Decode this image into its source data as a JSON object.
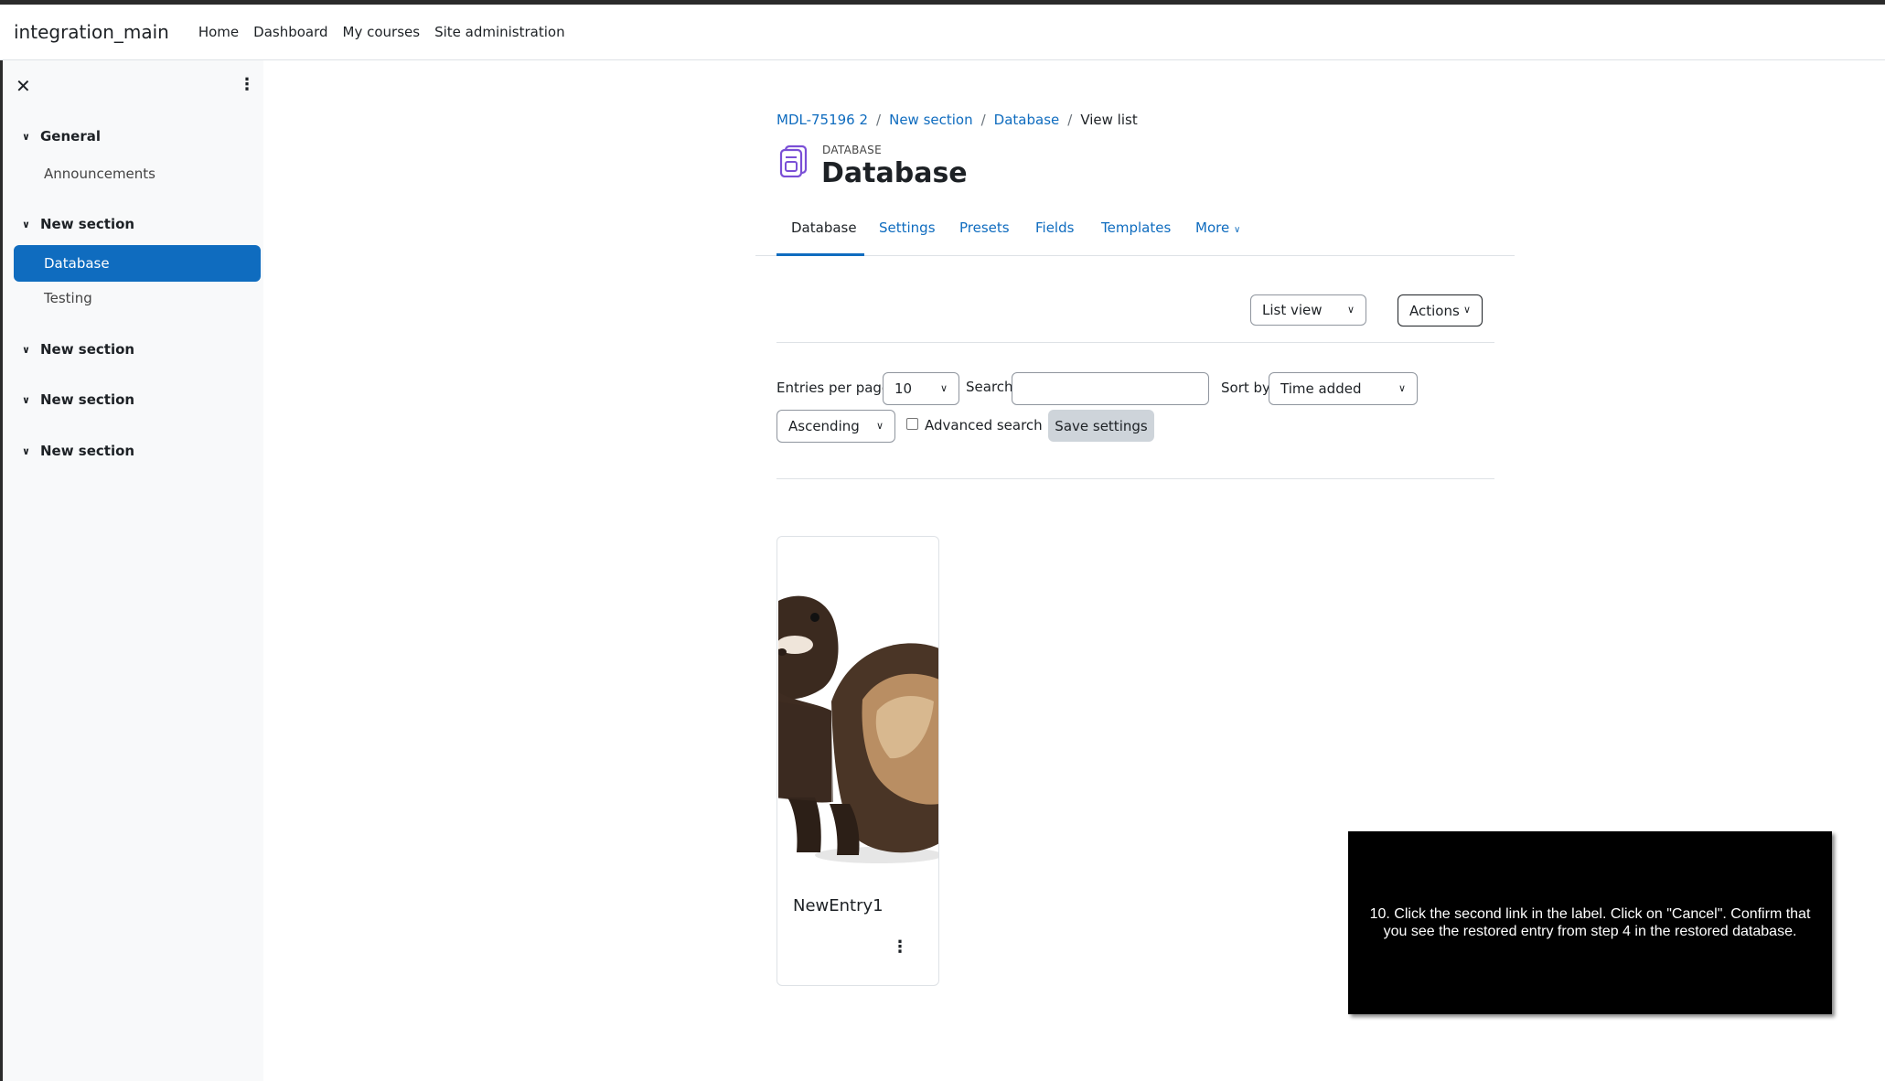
{
  "navbar": {
    "brand": "integration_main",
    "links": [
      "Home",
      "Dashboard",
      "My courses",
      "Site administration"
    ]
  },
  "drawer": {
    "close_glyph": "✕",
    "sections": [
      {
        "title": "General",
        "items": [
          "Announcements"
        ]
      },
      {
        "title": "New section",
        "items": [
          "Database",
          "Testing"
        ],
        "active_item": "Database"
      },
      {
        "title": "New section",
        "items": []
      },
      {
        "title": "New section",
        "items": []
      },
      {
        "title": "New section",
        "items": []
      }
    ]
  },
  "breadcrumb": {
    "items": [
      "MDL-75196 2",
      "New section",
      "Database"
    ],
    "current": "View list",
    "separator": "/"
  },
  "header": {
    "module_type": "DATABASE",
    "title": "Database",
    "icon": "database-module-icon"
  },
  "tabs": {
    "items": [
      "Database",
      "Settings",
      "Presets",
      "Fields",
      "Templates",
      "More"
    ],
    "active": "Database"
  },
  "view_controls": {
    "view_select": "List view",
    "actions_label": "Actions"
  },
  "filters": {
    "entries_per_page_label": "Entries per page",
    "entries_per_page_value": "10",
    "search_label": "Search",
    "search_value": "",
    "sort_by_label": "Sort by",
    "sort_by_value": "Time added",
    "order_value": "Ascending",
    "advanced_search_label": "Advanced search",
    "advanced_search_checked": false,
    "save_label": "Save settings"
  },
  "entries": [
    {
      "title": "NewEntry1",
      "image": "ferret-photo"
    }
  ],
  "overlay": {
    "text": "10. Click the second link in the label. Click on \"Cancel\". Confirm that you see the restored entry from step 4 in the restored database."
  },
  "colors": {
    "primary": "#0f6cbf",
    "text": "#1d2125",
    "drawer_bg": "#f8f9fa",
    "button_secondary": "#ced4da"
  }
}
